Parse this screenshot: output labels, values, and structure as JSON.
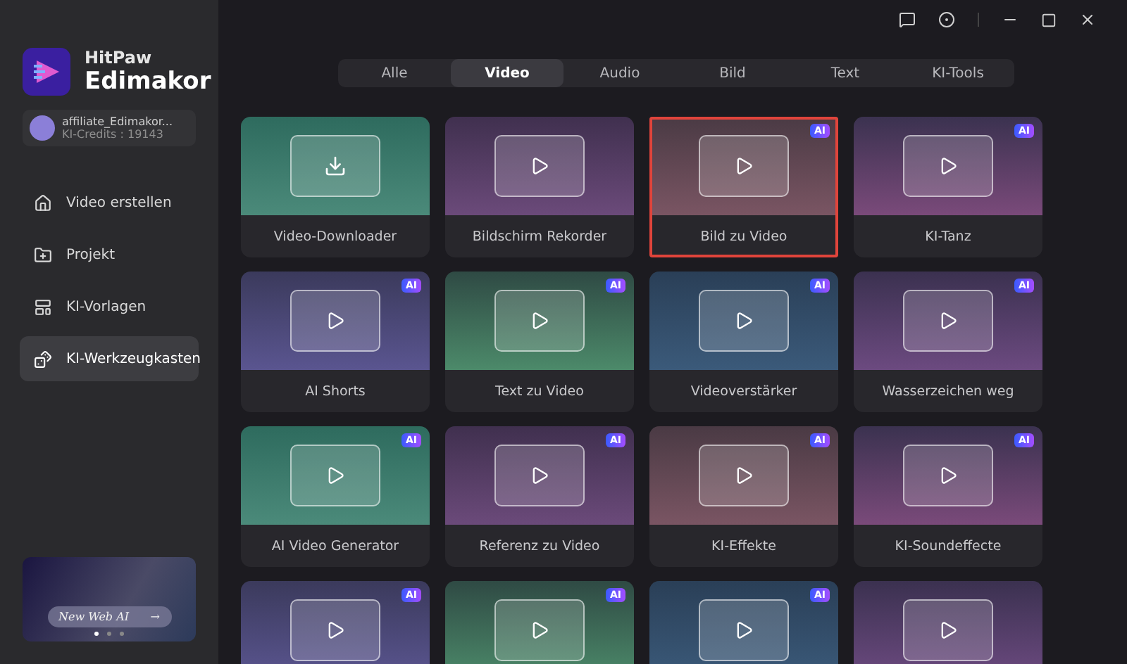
{
  "app": {
    "brand_small": "HitPaw",
    "brand_large": "Edimakor"
  },
  "account": {
    "name": "affiliate_Edimakor...",
    "credits": "KI-Credits : 19143"
  },
  "sidebar": {
    "items": [
      {
        "label": "Video erstellen",
        "selected": false
      },
      {
        "label": "Projekt",
        "selected": false
      },
      {
        "label": "KI-Vorlagen",
        "selected": false
      },
      {
        "label": "KI-Werkzeugkasten",
        "selected": true
      }
    ]
  },
  "banner": {
    "label": "New Web AI",
    "arrow": "→",
    "dots": [
      {
        "selected": true
      },
      {
        "selected": false
      },
      {
        "selected": false
      }
    ]
  },
  "tabs": [
    {
      "label": "Alle",
      "selected": false
    },
    {
      "label": "Video",
      "selected": true
    },
    {
      "label": "Audio",
      "selected": false
    },
    {
      "label": "Bild",
      "selected": false
    },
    {
      "label": "Text",
      "selected": false
    },
    {
      "label": "KI-Tools",
      "selected": false
    }
  ],
  "tools": [
    {
      "label": "Video-Downloader",
      "selected": false
    },
    {
      "label": "Bildschirm Rekorder",
      "selected": false
    },
    {
      "label": "Bild zu Video",
      "badge": "AI",
      "selected": true
    },
    {
      "label": "KI-Tanz",
      "badge": "AI",
      "selected": false
    },
    {
      "label": "AI Shorts",
      "badge": "AI",
      "selected": false
    },
    {
      "label": "Text zu Video",
      "badge": "AI",
      "selected": false
    },
    {
      "label": "Videoverstärker",
      "badge": "AI",
      "selected": false
    },
    {
      "label": "Wasserzeichen weg",
      "badge": "AI",
      "selected": false
    },
    {
      "label": "AI Video Generator",
      "badge": "AI",
      "selected": false
    },
    {
      "label": "Referenz zu Video",
      "badge": "AI",
      "selected": false
    },
    {
      "label": "KI-Effekte",
      "badge": "AI",
      "selected": false
    },
    {
      "label": "KI-Soundeffecte",
      "badge": "AI",
      "selected": false
    },
    {
      "badge": "AI",
      "selected": false
    },
    {
      "badge": "AI",
      "selected": false
    },
    {
      "badge": "AI",
      "selected": false
    },
    {
      "selected": false
    }
  ]
}
